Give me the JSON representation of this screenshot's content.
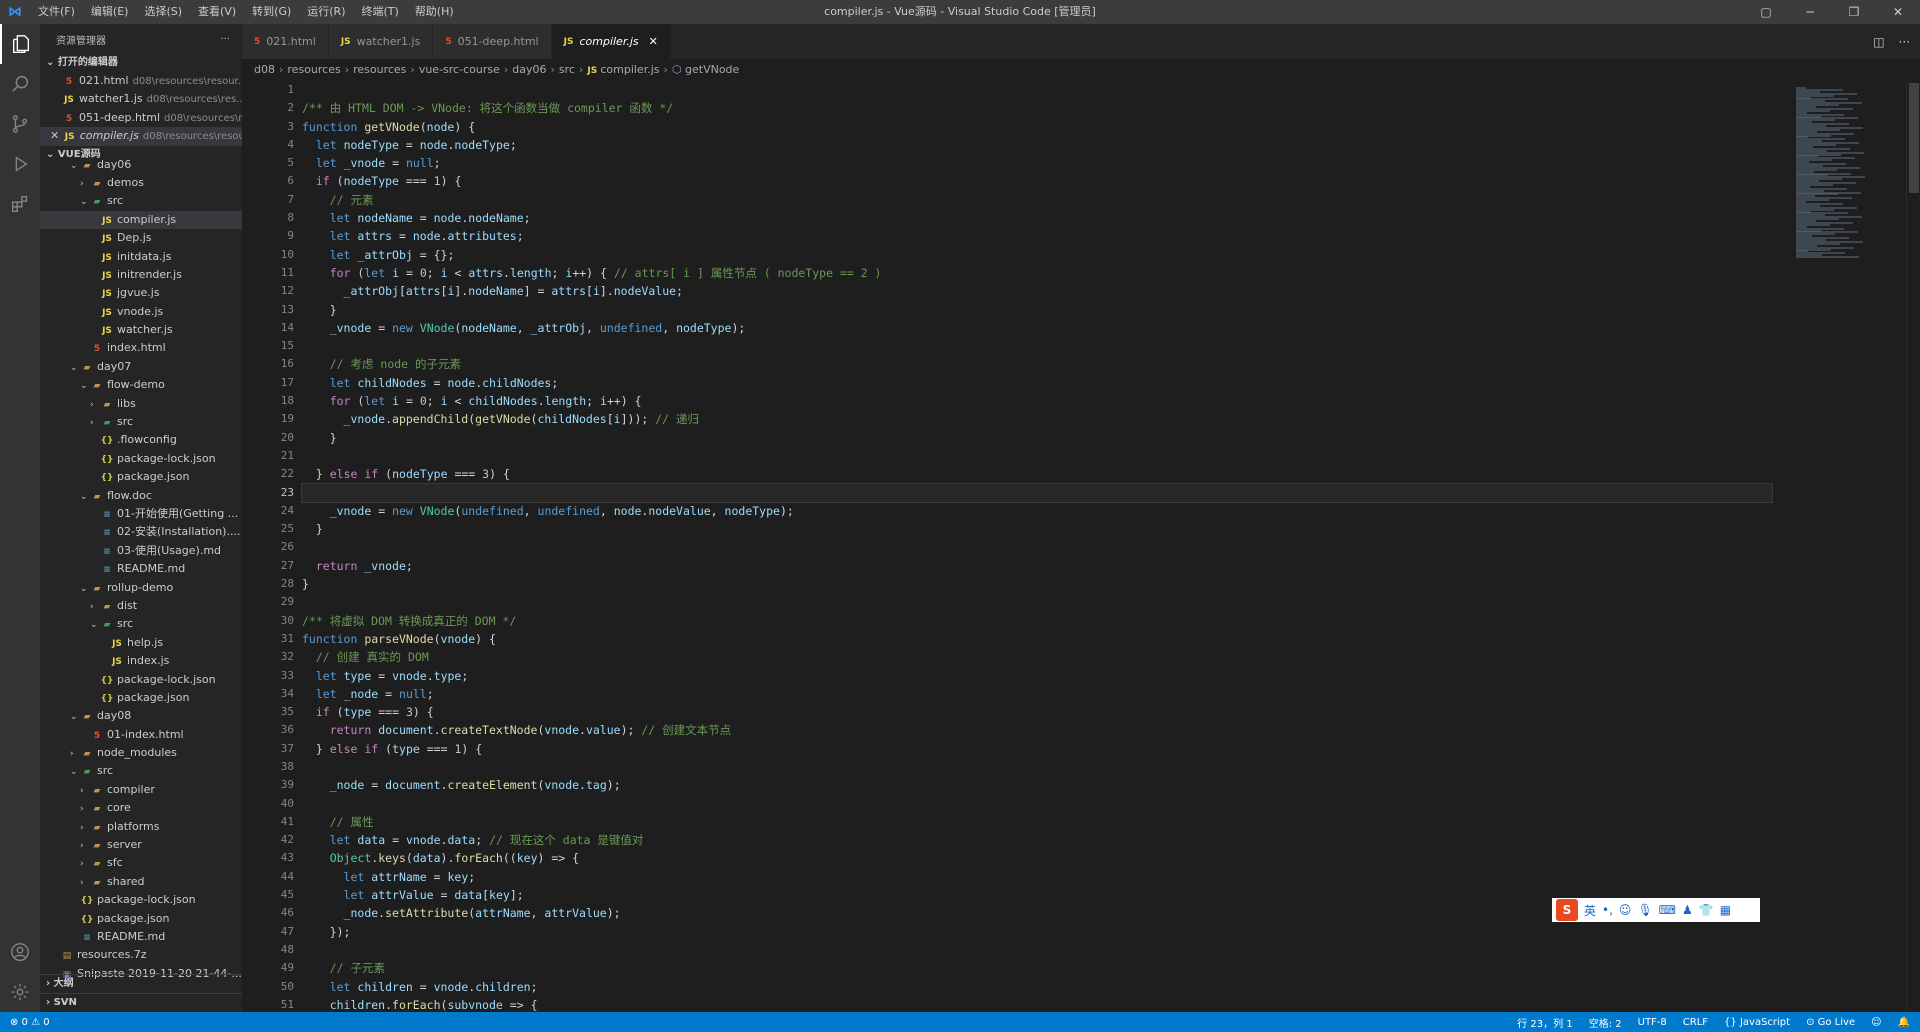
{
  "window": {
    "title": "compiler.js - Vue源码 - Visual Studio Code [管理员]"
  },
  "menu": [
    "文件(F)",
    "编辑(E)",
    "选择(S)",
    "查看(V)",
    "转到(G)",
    "运行(R)",
    "终端(T)",
    "帮助(H)"
  ],
  "sidebar": {
    "title": "资源管理器",
    "open_editors_label": "打开的编辑器",
    "open_editors": [
      {
        "name": "021.html",
        "desc": "d08\\resources\\resour...",
        "type": "html"
      },
      {
        "name": "watcher1.js",
        "desc": "d08\\resources\\res...",
        "type": "js"
      },
      {
        "name": "051-deep.html",
        "desc": "d08\\resources\\res...",
        "type": "html"
      },
      {
        "name": "compiler.js",
        "desc": "d08\\resources\\resou...",
        "type": "js"
      }
    ],
    "project_label": "VUE源码",
    "tree": [
      {
        "name": "day06",
        "type": "folder",
        "depth": 3,
        "open": true
      },
      {
        "name": "demos",
        "type": "folder",
        "depth": 4,
        "open": false
      },
      {
        "name": "src",
        "type": "src",
        "depth": 4,
        "open": true
      },
      {
        "name": "compiler.js",
        "type": "js",
        "depth": 5,
        "selected": true
      },
      {
        "name": "Dep.js",
        "type": "js",
        "depth": 5
      },
      {
        "name": "initdata.js",
        "type": "js",
        "depth": 5
      },
      {
        "name": "initrender.js",
        "type": "js",
        "depth": 5
      },
      {
        "name": "jgvue.js",
        "type": "js",
        "depth": 5
      },
      {
        "name": "vnode.js",
        "type": "js",
        "depth": 5
      },
      {
        "name": "watcher.js",
        "type": "js",
        "depth": 5
      },
      {
        "name": "index.html",
        "type": "html",
        "depth": 4
      },
      {
        "name": "day07",
        "type": "folder",
        "depth": 3,
        "open": true
      },
      {
        "name": "flow-demo",
        "type": "folder",
        "depth": 4,
        "open": true
      },
      {
        "name": "libs",
        "type": "folder",
        "depth": 5,
        "open": false
      },
      {
        "name": "src",
        "type": "src",
        "depth": 5,
        "open": false
      },
      {
        "name": ".flowconfig",
        "type": "json",
        "depth": 5
      },
      {
        "name": "package-lock.json",
        "type": "json",
        "depth": 5
      },
      {
        "name": "package.json",
        "type": "json",
        "depth": 5
      },
      {
        "name": "flow.doc",
        "type": "folder",
        "depth": 4,
        "open": true
      },
      {
        "name": "01-开始使用(Getting ...",
        "type": "md",
        "depth": 5
      },
      {
        "name": "02-安装(Installation)....",
        "type": "md",
        "depth": 5
      },
      {
        "name": "03-使用(Usage).md",
        "type": "md",
        "depth": 5
      },
      {
        "name": "README.md",
        "type": "md",
        "depth": 5
      },
      {
        "name": "rollup-demo",
        "type": "folder",
        "depth": 4,
        "open": true
      },
      {
        "name": "dist",
        "type": "folder",
        "depth": 5,
        "open": false
      },
      {
        "name": "src",
        "type": "src",
        "depth": 5,
        "open": true
      },
      {
        "name": "help.js",
        "type": "js",
        "depth": 6
      },
      {
        "name": "index.js",
        "type": "js",
        "depth": 6
      },
      {
        "name": "package-lock.json",
        "type": "json",
        "depth": 5
      },
      {
        "name": "package.json",
        "type": "json",
        "depth": 5
      },
      {
        "name": "day08",
        "type": "folder",
        "depth": 3,
        "open": true
      },
      {
        "name": "01-index.html",
        "type": "html",
        "depth": 4
      },
      {
        "name": "node_modules",
        "type": "folder",
        "depth": 3,
        "open": false
      },
      {
        "name": "src",
        "type": "src",
        "depth": 3,
        "open": true
      },
      {
        "name": "compiler",
        "type": "folder",
        "depth": 4,
        "open": false
      },
      {
        "name": "core",
        "type": "folder",
        "depth": 4,
        "open": false
      },
      {
        "name": "platforms",
        "type": "folder",
        "depth": 4,
        "open": false
      },
      {
        "name": "server",
        "type": "folder",
        "depth": 4,
        "open": false
      },
      {
        "name": "sfc",
        "type": "folder",
        "depth": 4,
        "open": false
      },
      {
        "name": "shared",
        "type": "folder",
        "depth": 4,
        "open": false
      },
      {
        "name": "package-lock.json",
        "type": "json",
        "depth": 3
      },
      {
        "name": "package.json",
        "type": "json",
        "depth": 3
      },
      {
        "name": "README.md",
        "type": "md",
        "depth": 3
      },
      {
        "name": "resources.7z",
        "type": "zip",
        "depth": 1
      },
      {
        "name": "Snipaste 2019-11-20 21-44-...",
        "type": "img",
        "depth": 1
      }
    ],
    "outline_label": "大纲",
    "svn_label": "SVN"
  },
  "tabs": [
    {
      "name": "021.html",
      "type": "html",
      "active": false
    },
    {
      "name": "watcher1.js",
      "type": "js",
      "active": false
    },
    {
      "name": "051-deep.html",
      "type": "html",
      "active": false
    },
    {
      "name": "compiler.js",
      "type": "js",
      "active": true
    }
  ],
  "tab_close": "✕",
  "breadcrumb": [
    "d08",
    "resources",
    "resources",
    "vue-src-course",
    "day06",
    "src",
    "compiler.js",
    "getVNode"
  ],
  "editor": {
    "current_line": 23,
    "lines": [
      "",
      "/** 由 HTML DOM -> VNode: 将这个函数当做 compiler 函数 */",
      "function getVNode(node) {",
      "  let nodeType = node.nodeType;",
      "  let _vnode = null;",
      "  if (nodeType === 1) {",
      "    // 元素",
      "    let nodeName = node.nodeName;",
      "    let attrs = node.attributes;",
      "    let _attrObj = {};",
      "    for (let i = 0; i < attrs.length; i++) { // attrs[ i ] 属性节点 ( nodeType == 2 )",
      "      _attrObj[attrs[i].nodeName] = attrs[i].nodeValue;",
      "    }",
      "    _vnode = new VNode(nodeName, _attrObj, undefined, nodeType);",
      "",
      "    // 考虑 node 的子元素",
      "    let childNodes = node.childNodes;",
      "    for (let i = 0; i < childNodes.length; i++) {",
      "      _vnode.appendChild(getVNode(childNodes[i])); // 递归",
      "    }",
      "",
      "  } else if (nodeType === 3) {",
      "",
      "    _vnode = new VNode(undefined, undefined, node.nodeValue, nodeType);",
      "  }",
      "",
      "  return _vnode;",
      "}",
      "",
      "/** 将虚拟 DOM 转换成真正的 DOM */",
      "function parseVNode(vnode) {",
      "  // 创建 真实的 DOM",
      "  let type = vnode.type;",
      "  let _node = null;",
      "  if (type === 3) {",
      "    return document.createTextNode(vnode.value); // 创建文本节点",
      "  } else if (type === 1) {",
      "",
      "    _node = document.createElement(vnode.tag);",
      "",
      "    // 属性",
      "    let data = vnode.data; // 现在这个 data 是键值对",
      "    Object.keys(data).forEach((key) => {",
      "      let attrName = key;",
      "      let attrValue = data[key];",
      "      _node.setAttribute(attrName, attrValue);",
      "    });",
      "",
      "    // 子元素",
      "    let children = vnode.children;",
      "    children.forEach(subvnode => {"
    ]
  },
  "ime": {
    "label": "英",
    "punct": "•,"
  },
  "status": {
    "errors": "⊗ 0",
    "warnings": "⚠ 0",
    "position": "行 23，列 1",
    "spaces": "空格: 2",
    "encoding": "UTF-8",
    "eol": "CRLF",
    "language": "{} JavaScript",
    "golive": "⊙ Go Live"
  },
  "colors": {
    "statusbar": "#007acc",
    "activity": "#333333",
    "sidebar": "#252526",
    "editor": "#1e1e1e"
  }
}
